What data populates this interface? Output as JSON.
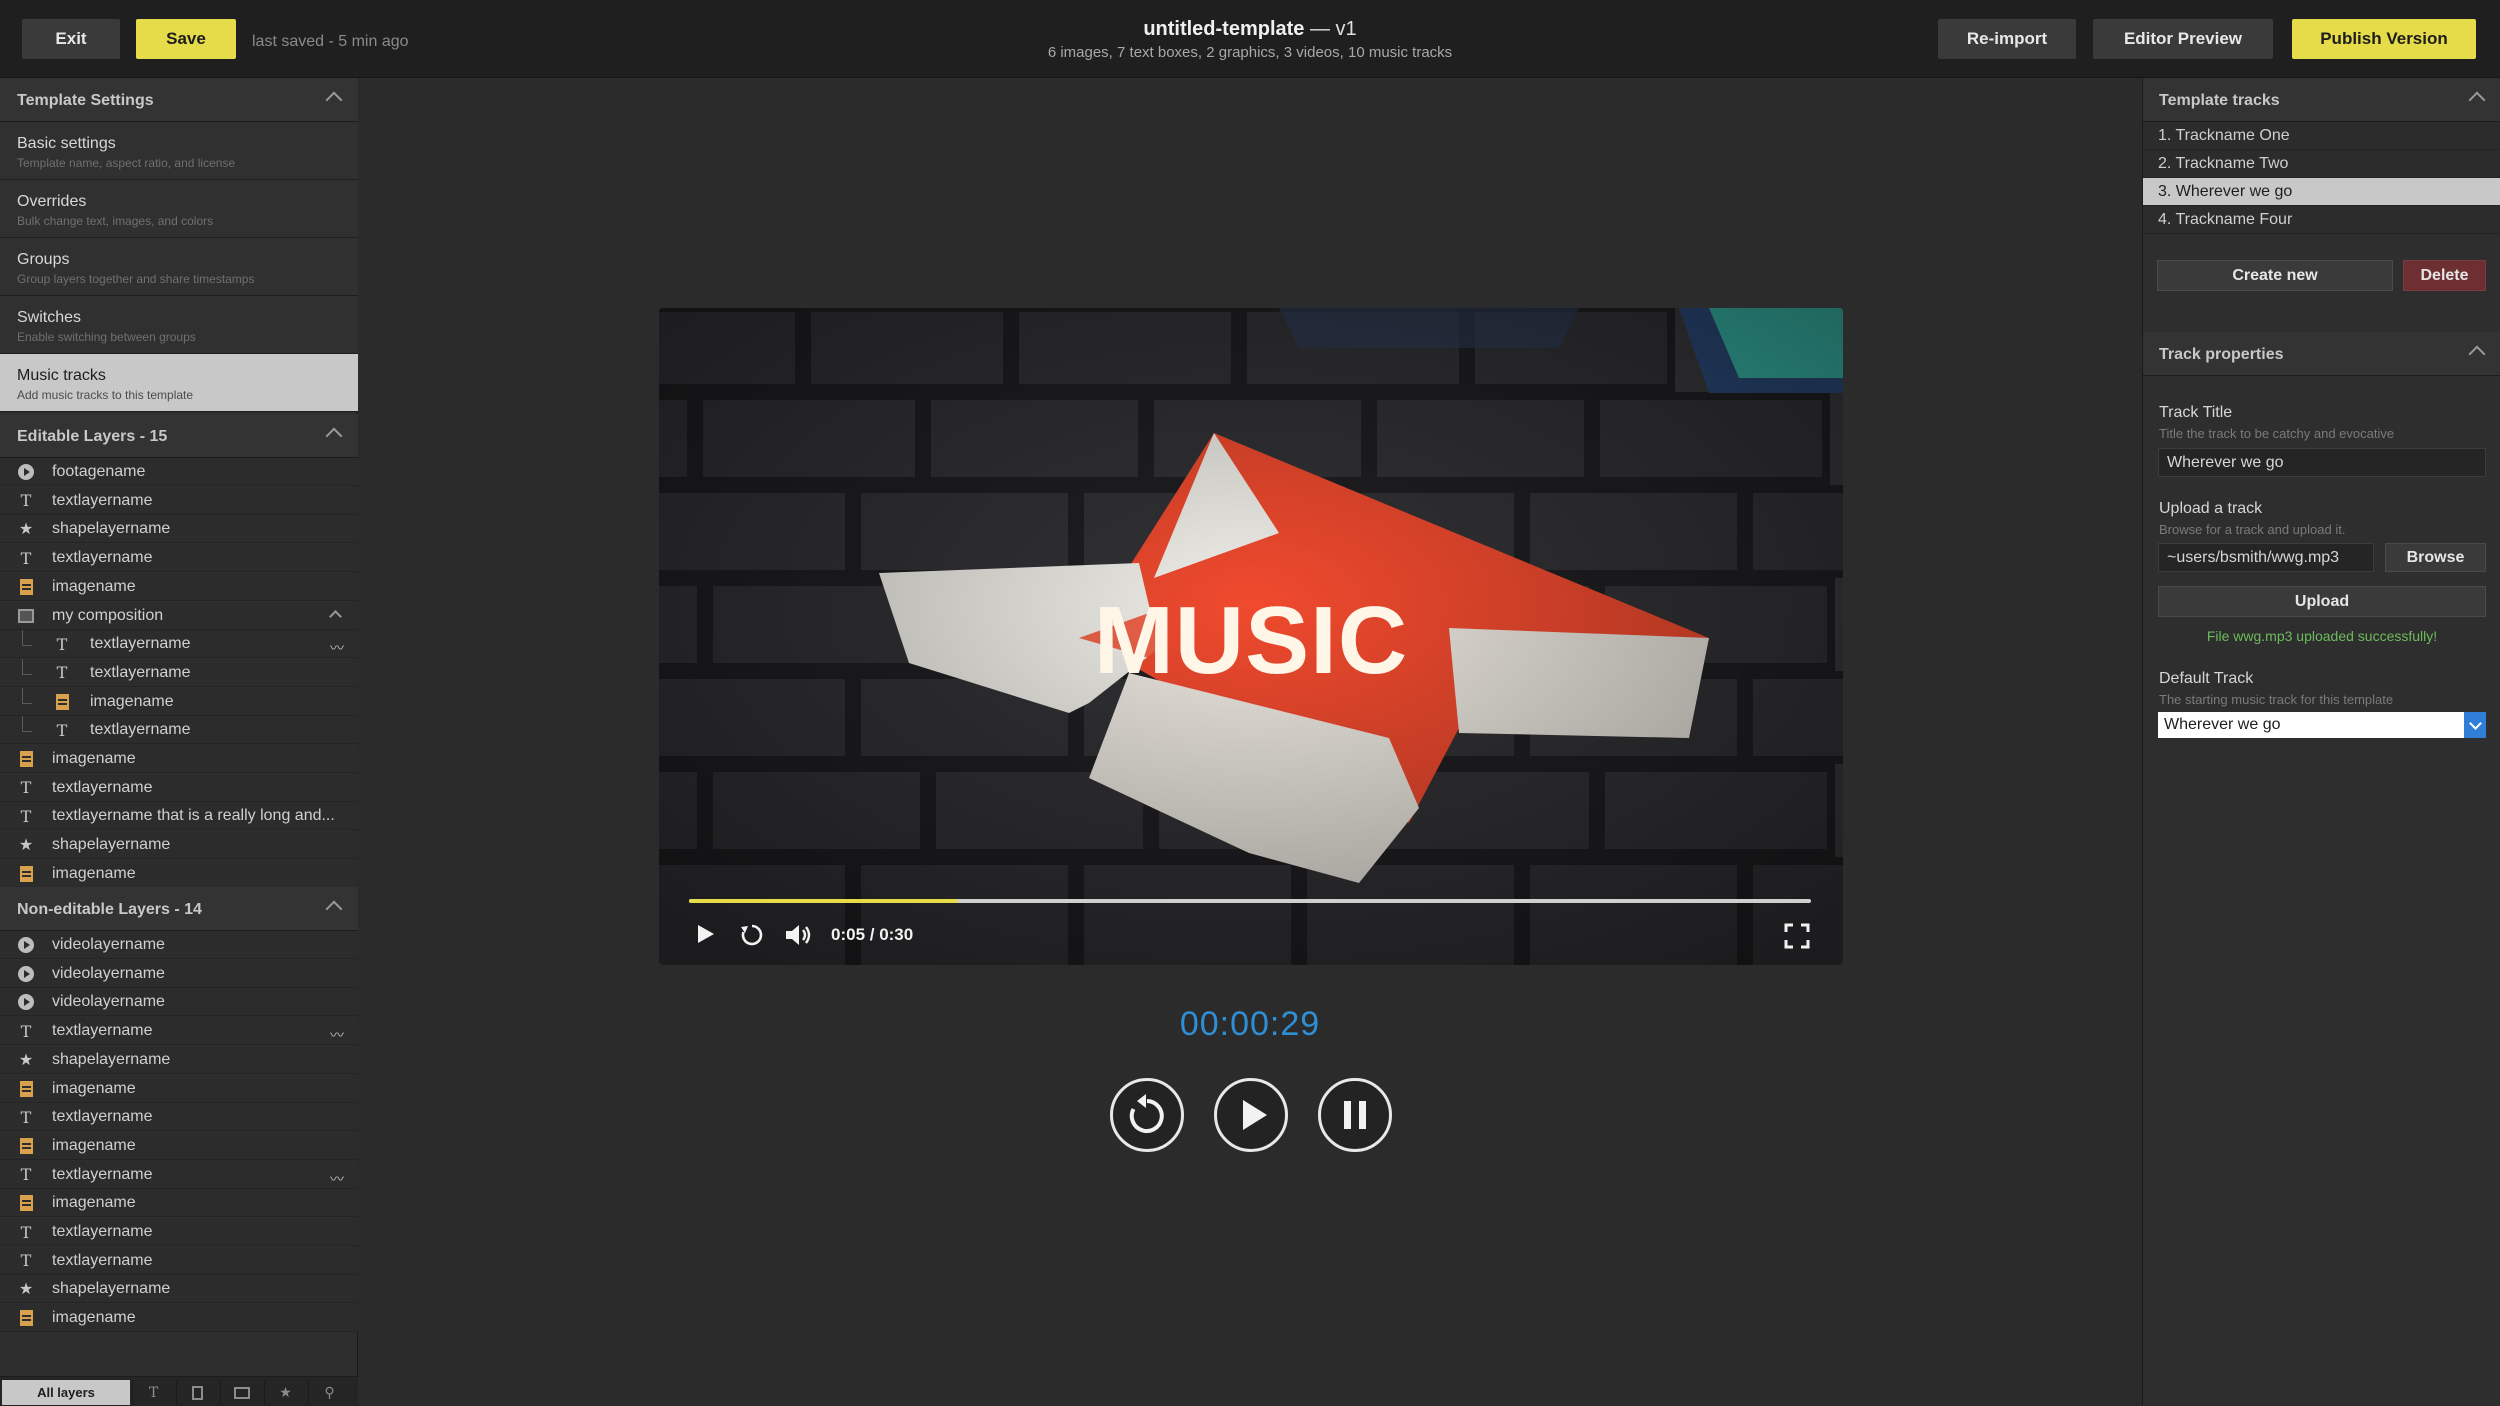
{
  "topbar": {
    "exit_label": "Exit",
    "save_label": "Save",
    "last_saved": "last saved - 5 min ago",
    "title": "untitled-template",
    "version": " — v1",
    "subtitle": "6 images, 7 text boxes, 2 graphics, 3 videos, 10 music tracks",
    "reimport_label": "Re-import",
    "editor_preview_label": "Editor Preview",
    "publish_label": "Publish Version"
  },
  "template_settings": {
    "heading": "Template Settings",
    "items": [
      {
        "name": "Basic settings",
        "desc": "Template name, aspect ratio, and license"
      },
      {
        "name": "Overrides",
        "desc": "Bulk change text, images, and colors"
      },
      {
        "name": "Groups",
        "desc": "Group layers together and share timestamps"
      },
      {
        "name": "Switches",
        "desc": "Enable switching between groups"
      },
      {
        "name": "Music tracks",
        "desc": "Add music tracks to this template"
      }
    ]
  },
  "editable_layers": {
    "heading": "Editable Layers - 15",
    "items": [
      {
        "icon": "video-icon",
        "label": "footagename"
      },
      {
        "icon": "text-icon",
        "label": "textlayername"
      },
      {
        "icon": "star-icon",
        "label": "shapelayername"
      },
      {
        "icon": "text-icon",
        "label": "textlayername"
      },
      {
        "icon": "image-icon",
        "label": "imagename"
      },
      {
        "icon": "composition-icon",
        "label": "my composition"
      },
      {
        "icon": "text-icon",
        "label": "textlayername"
      },
      {
        "icon": "text-icon",
        "label": "textlayername"
      },
      {
        "icon": "image-icon",
        "label": "imagename"
      },
      {
        "icon": "text-icon",
        "label": "textlayername"
      },
      {
        "icon": "image-icon",
        "label": "imagename"
      },
      {
        "icon": "text-icon",
        "label": "textlayername"
      },
      {
        "icon": "text-icon",
        "label": "textlayername that is a really long and..."
      },
      {
        "icon": "star-icon",
        "label": "shapelayername"
      },
      {
        "icon": "image-icon",
        "label": "imagename"
      }
    ]
  },
  "non_editable_layers": {
    "heading": "Non-editable Layers - 14",
    "items": [
      {
        "icon": "video-icon",
        "label": "videolayername"
      },
      {
        "icon": "video-icon",
        "label": "videolayername"
      },
      {
        "icon": "video-icon",
        "label": "videolayername"
      },
      {
        "icon": "text-icon",
        "label": "textlayername"
      },
      {
        "icon": "star-icon",
        "label": "shapelayername"
      },
      {
        "icon": "image-icon",
        "label": "imagename"
      },
      {
        "icon": "text-icon",
        "label": "textlayername"
      },
      {
        "icon": "image-icon",
        "label": "imagename"
      },
      {
        "icon": "text-icon",
        "label": "textlayername"
      },
      {
        "icon": "image-icon",
        "label": "imagename"
      },
      {
        "icon": "text-icon",
        "label": "textlayername"
      },
      {
        "icon": "text-icon",
        "label": "textlayername"
      },
      {
        "icon": "star-icon",
        "label": "shapelayername"
      },
      {
        "icon": "image-icon",
        "label": "imagename"
      }
    ]
  },
  "filter_bar": {
    "all_label": "All layers"
  },
  "player": {
    "overlay_word": "MUSIC",
    "time_display": "0:05 / 0:30",
    "progress_fraction": 0.24,
    "timecode": "00:00:29"
  },
  "template_tracks": {
    "heading": "Template tracks",
    "items": [
      {
        "label": "1. Trackname One"
      },
      {
        "label": "2. Trackname Two"
      },
      {
        "label": "3. Wherever we go"
      },
      {
        "label": "4. Trackname Four"
      }
    ],
    "selected_index": 2,
    "create_label": "Create new",
    "delete_label": "Delete"
  },
  "track_properties": {
    "heading": "Track properties",
    "title_label": "Track Title",
    "title_hint": "Title the track to be catchy and evocative",
    "title_value": "Wherever we go",
    "upload_label": "Upload a track",
    "upload_hint": "Browse for a track and upload it.",
    "file_path": "~users/bsmith/wwg.mp3",
    "browse_label": "Browse",
    "upload_button": "Upload",
    "success_msg": "File wwg.mp3 uploaded successfully!",
    "default_label": "Default Track",
    "default_hint": "The starting music track for this template",
    "default_value": "Wherever we go"
  },
  "colors": {
    "accent_yellow": "#e6dc4a",
    "timecode_blue": "#2f8fd6",
    "success_green": "#6dbb5c",
    "delete_red": "#6e2f33"
  }
}
